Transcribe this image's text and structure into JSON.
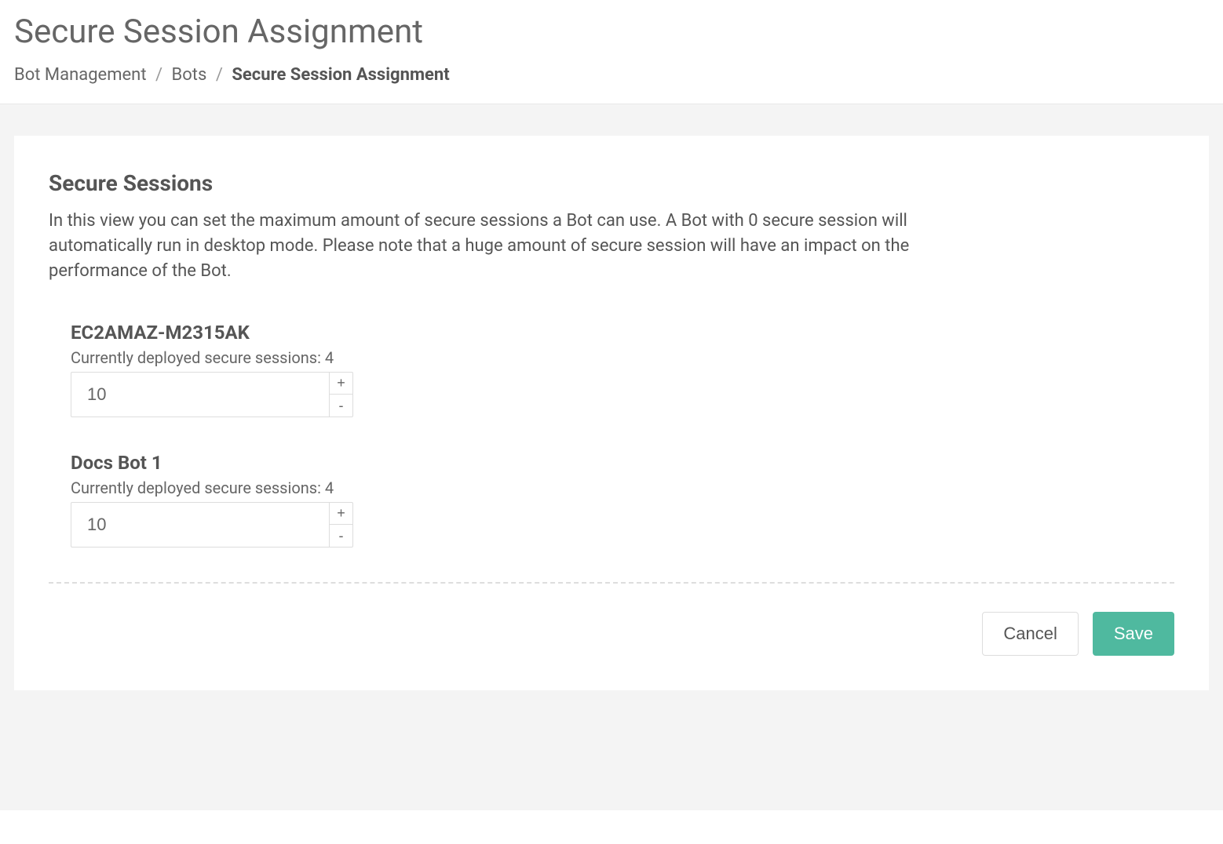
{
  "header": {
    "title": "Secure Session Assignment",
    "breadcrumb": {
      "item1": "Bot Management",
      "item2": "Bots",
      "current": "Secure Session Assignment"
    }
  },
  "panel": {
    "section_title": "Secure Sessions",
    "description": "In this view you can set the maximum amount of secure sessions a Bot can use. A Bot with 0 secure session will automatically run in desktop mode. Please note that a huge amount of secure session will have an impact on the performance of the Bot."
  },
  "bots": [
    {
      "name": "EC2AMAZ-M2315AK",
      "deployed_label": "Currently deployed secure sessions: 4",
      "value": "10"
    },
    {
      "name": "Docs Bot 1",
      "deployed_label": "Currently deployed secure sessions: 4",
      "value": "10"
    }
  ],
  "actions": {
    "cancel": "Cancel",
    "save": "Save"
  },
  "stepper": {
    "plus": "+",
    "minus": "-"
  }
}
